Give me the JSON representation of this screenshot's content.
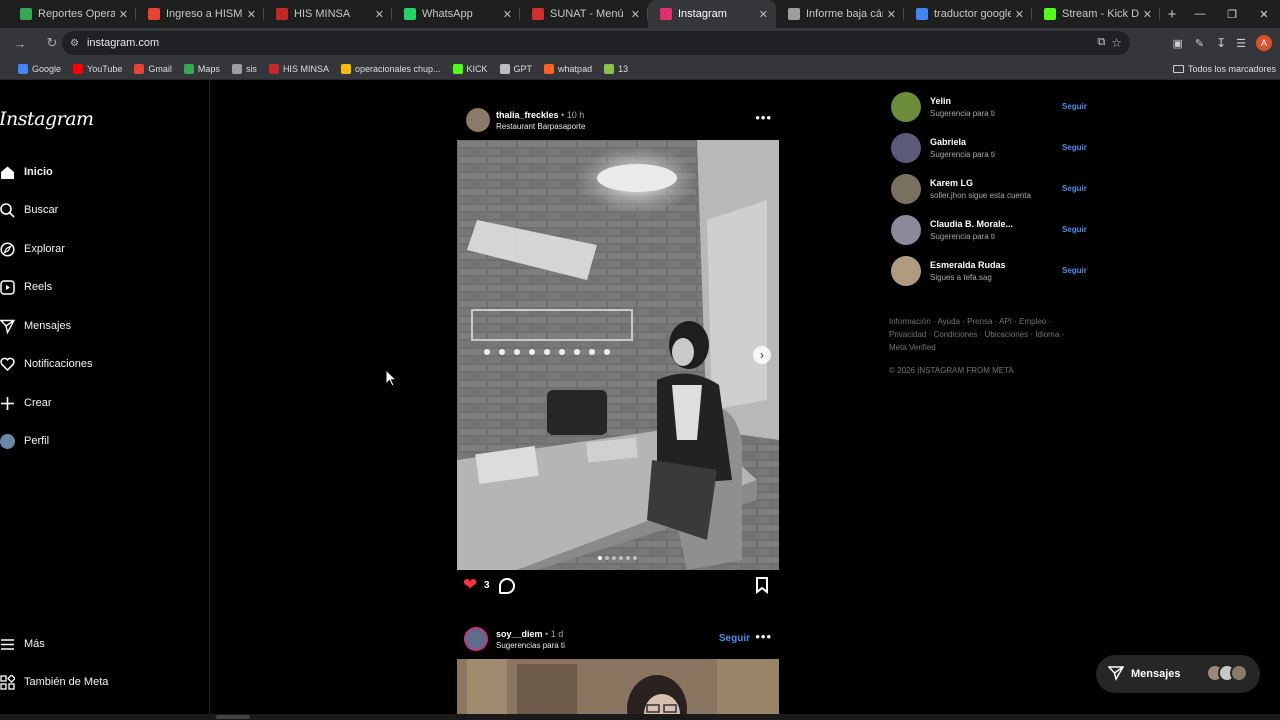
{
  "browser": {
    "tabs": [
      {
        "title": "Reportes Operacionales",
        "favicon_color": "#34a853",
        "active": false
      },
      {
        "title": "Ingreso a HISMINSA",
        "favicon_color": "#ea4335",
        "active": false
      },
      {
        "title": "HIS MINSA",
        "favicon_color": "#c62828",
        "active": false
      },
      {
        "title": "WhatsApp",
        "favicon_color": "#25d366",
        "active": false
      },
      {
        "title": "SUNAT - Menú SOL",
        "favicon_color": "#d32f2f",
        "active": false
      },
      {
        "title": "Instagram",
        "favicon_color": "#e1306c",
        "active": true
      },
      {
        "title": "Informe baja cámara",
        "favicon_color": "#9e9e9e",
        "active": false
      },
      {
        "title": "traductor google - Bu",
        "favicon_color": "#4285f4",
        "active": false
      },
      {
        "title": "Stream - Kick Dashbo",
        "favicon_color": "#53fc18",
        "active": false
      }
    ],
    "url": "instagram.com",
    "profile_initial": "A",
    "bookmarks": [
      {
        "label": "Google",
        "color": "#4285f4"
      },
      {
        "label": "YouTube",
        "color": "#ff0000"
      },
      {
        "label": "Gmail",
        "color": "#ea4335"
      },
      {
        "label": "Maps",
        "color": "#34a853"
      },
      {
        "label": "sis",
        "color": "#9e9e9e"
      },
      {
        "label": "HIS MINSA",
        "color": "#c62828"
      },
      {
        "label": "operacionales chup...",
        "color": "#fbbc04"
      },
      {
        "label": "KICK",
        "color": "#53fc18"
      },
      {
        "label": "GPT",
        "color": "#bdbdbd"
      },
      {
        "label": "whatpad",
        "color": "#ff6122"
      },
      {
        "label": "13",
        "color": "#8bc34a"
      }
    ],
    "all_bookmarks_label": "Todos los marcadores"
  },
  "sidebar": {
    "logo": "Instagram",
    "nav": [
      {
        "label": "Inicio",
        "icon": "home-icon",
        "active": true
      },
      {
        "label": "Buscar",
        "icon": "search-icon",
        "active": false
      },
      {
        "label": "Explorar",
        "icon": "compass-icon",
        "active": false
      },
      {
        "label": "Reels",
        "icon": "reels-icon",
        "active": false
      },
      {
        "label": "Mensajes",
        "icon": "send-icon",
        "active": false
      },
      {
        "label": "Notificaciones",
        "icon": "heart-icon",
        "active": false
      },
      {
        "label": "Crear",
        "icon": "plus-icon",
        "active": false
      },
      {
        "label": "Perfil",
        "icon": "avatar-icon",
        "active": false
      }
    ],
    "bottom": [
      {
        "label": "Más",
        "icon": "menu-icon"
      },
      {
        "label": "También de Meta",
        "icon": "meta-apps-icon"
      }
    ]
  },
  "feed": {
    "posts": [
      {
        "username": "thalia_freckles",
        "time": "• 10 h",
        "subtitle": "Restaurant Barpasaporte",
        "likes": "3",
        "carousel_count": 6,
        "carousel_index": 0
      },
      {
        "username": "soy__diem",
        "time": "• 1 d",
        "subtitle": "Sugerencias para ti",
        "follow": "Seguir"
      }
    ]
  },
  "suggestions": [
    {
      "name": "Yelin",
      "sub": "Sugerencia para ti",
      "follow": "Seguir",
      "color": "#6a8e3a"
    },
    {
      "name": "Gabriela",
      "sub": "Sugerencia para ti",
      "follow": "Seguir",
      "color": "#5a5a7a"
    },
    {
      "name": "Karem LG",
      "sub": "soller.jhon sigue esta cuenta",
      "follow": "Seguir",
      "color": "#7a7060"
    },
    {
      "name": "Claudia B. Morale...",
      "sub": "Sugerencia para ti",
      "follow": "Seguir",
      "color": "#8a8a9a"
    },
    {
      "name": "Esmeralda Rudas",
      "sub": "Sigues a tefa.sag",
      "follow": "Seguir",
      "color": "#b09a80"
    }
  ],
  "footer": {
    "links": "Información · Ayuda · Prensa · API · Empleo · Privacidad · Condiciones · Ubicaciones · Idioma · Meta Verified",
    "copyright": "© 2026 INSTAGRAM FROM META"
  },
  "messages_pill": {
    "label": "Mensajes"
  }
}
